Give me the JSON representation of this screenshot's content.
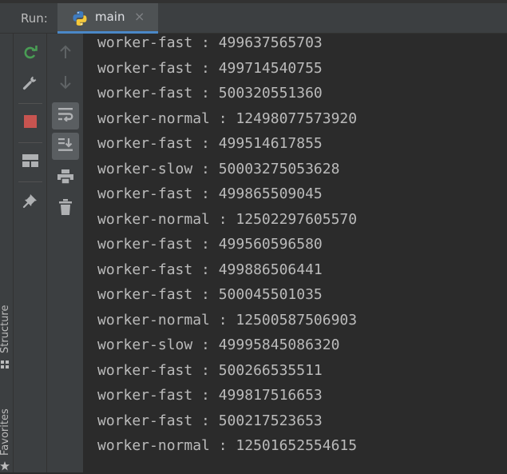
{
  "run_panel": {
    "title": "Run:",
    "tab": {
      "label": "main",
      "close_glyph": "×",
      "icon": "python-icon"
    }
  },
  "side_tools": {
    "structure": "Structure",
    "favorites": "Favorites"
  },
  "toolbar": {
    "rerun": "rerun-icon",
    "settings": "wrench-icon",
    "stop": "stop-icon",
    "layout": "layout-icon",
    "pin": "pin-icon",
    "up": "arrow-up-icon",
    "down": "arrow-down-icon",
    "soft_wrap": "soft-wrap-icon",
    "scroll_to_end": "scroll-to-end-icon",
    "print": "print-icon",
    "clear": "trash-icon"
  },
  "colors": {
    "rerun": "#499c54",
    "stop": "#c75450",
    "icon": "#afb1b3"
  },
  "console": {
    "lines": [
      "worker-fast : 499637565703",
      "worker-fast : 499714540755",
      "worker-fast : 500320551360",
      "worker-normal : 12498077573920",
      "worker-fast : 499514617855",
      "worker-slow : 50003275053628",
      "worker-fast : 499865509045",
      "worker-normal : 12502297605570",
      "worker-fast : 499560596580",
      "worker-fast : 499886506441",
      "worker-fast : 500045501035",
      "worker-normal : 12500587506903",
      "worker-slow : 49995845086320",
      "worker-fast : 500266535511",
      "worker-fast : 499817516653",
      "worker-fast : 500217523653",
      "worker-normal : 12501652554615"
    ]
  }
}
